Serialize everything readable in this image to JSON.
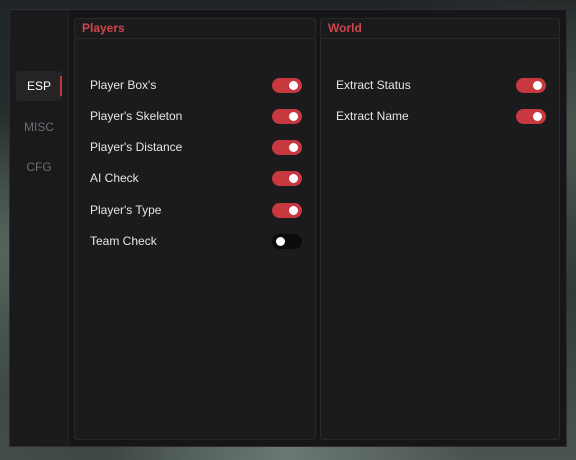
{
  "nav": {
    "items": [
      {
        "label": "ESP",
        "active": true
      },
      {
        "label": "MISC",
        "active": false
      },
      {
        "label": "CFG",
        "active": false
      }
    ]
  },
  "players_panel": {
    "title": "Players",
    "options": [
      {
        "label": "Player Box's",
        "enabled": true
      },
      {
        "label": "Player's Skeleton",
        "enabled": true
      },
      {
        "label": "Player's Distance",
        "enabled": true
      },
      {
        "label": "AI Check",
        "enabled": true
      },
      {
        "label": "Player's Type",
        "enabled": true
      },
      {
        "label": "Team Check",
        "enabled": false
      }
    ]
  },
  "world_panel": {
    "title": "World",
    "options": [
      {
        "label": "Extract Status",
        "enabled": true
      },
      {
        "label": "Extract Name",
        "enabled": true
      }
    ]
  },
  "colors": {
    "accent": "#c7383f",
    "header_text": "#d0454b",
    "toggle_off": "#0b0b0c",
    "window_bg": "#161618",
    "panel_bg": "#1b1b1d"
  }
}
